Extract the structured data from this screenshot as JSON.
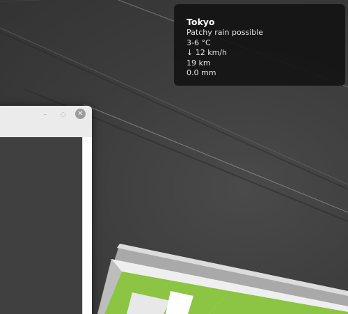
{
  "weather": {
    "city": "Tokyo",
    "condition": "Patchy rain possible",
    "temperature": "3-6 °C",
    "wind": "↓ 12 km/h",
    "visibility": "19 km",
    "precipitation": "0.0 mm"
  },
  "window": {
    "minimize_glyph": "–",
    "maximize_glyph": "◌",
    "close_glyph": "✕"
  },
  "colors": {
    "logo_green": "#8cc443",
    "desklet_bg": "#141414"
  }
}
